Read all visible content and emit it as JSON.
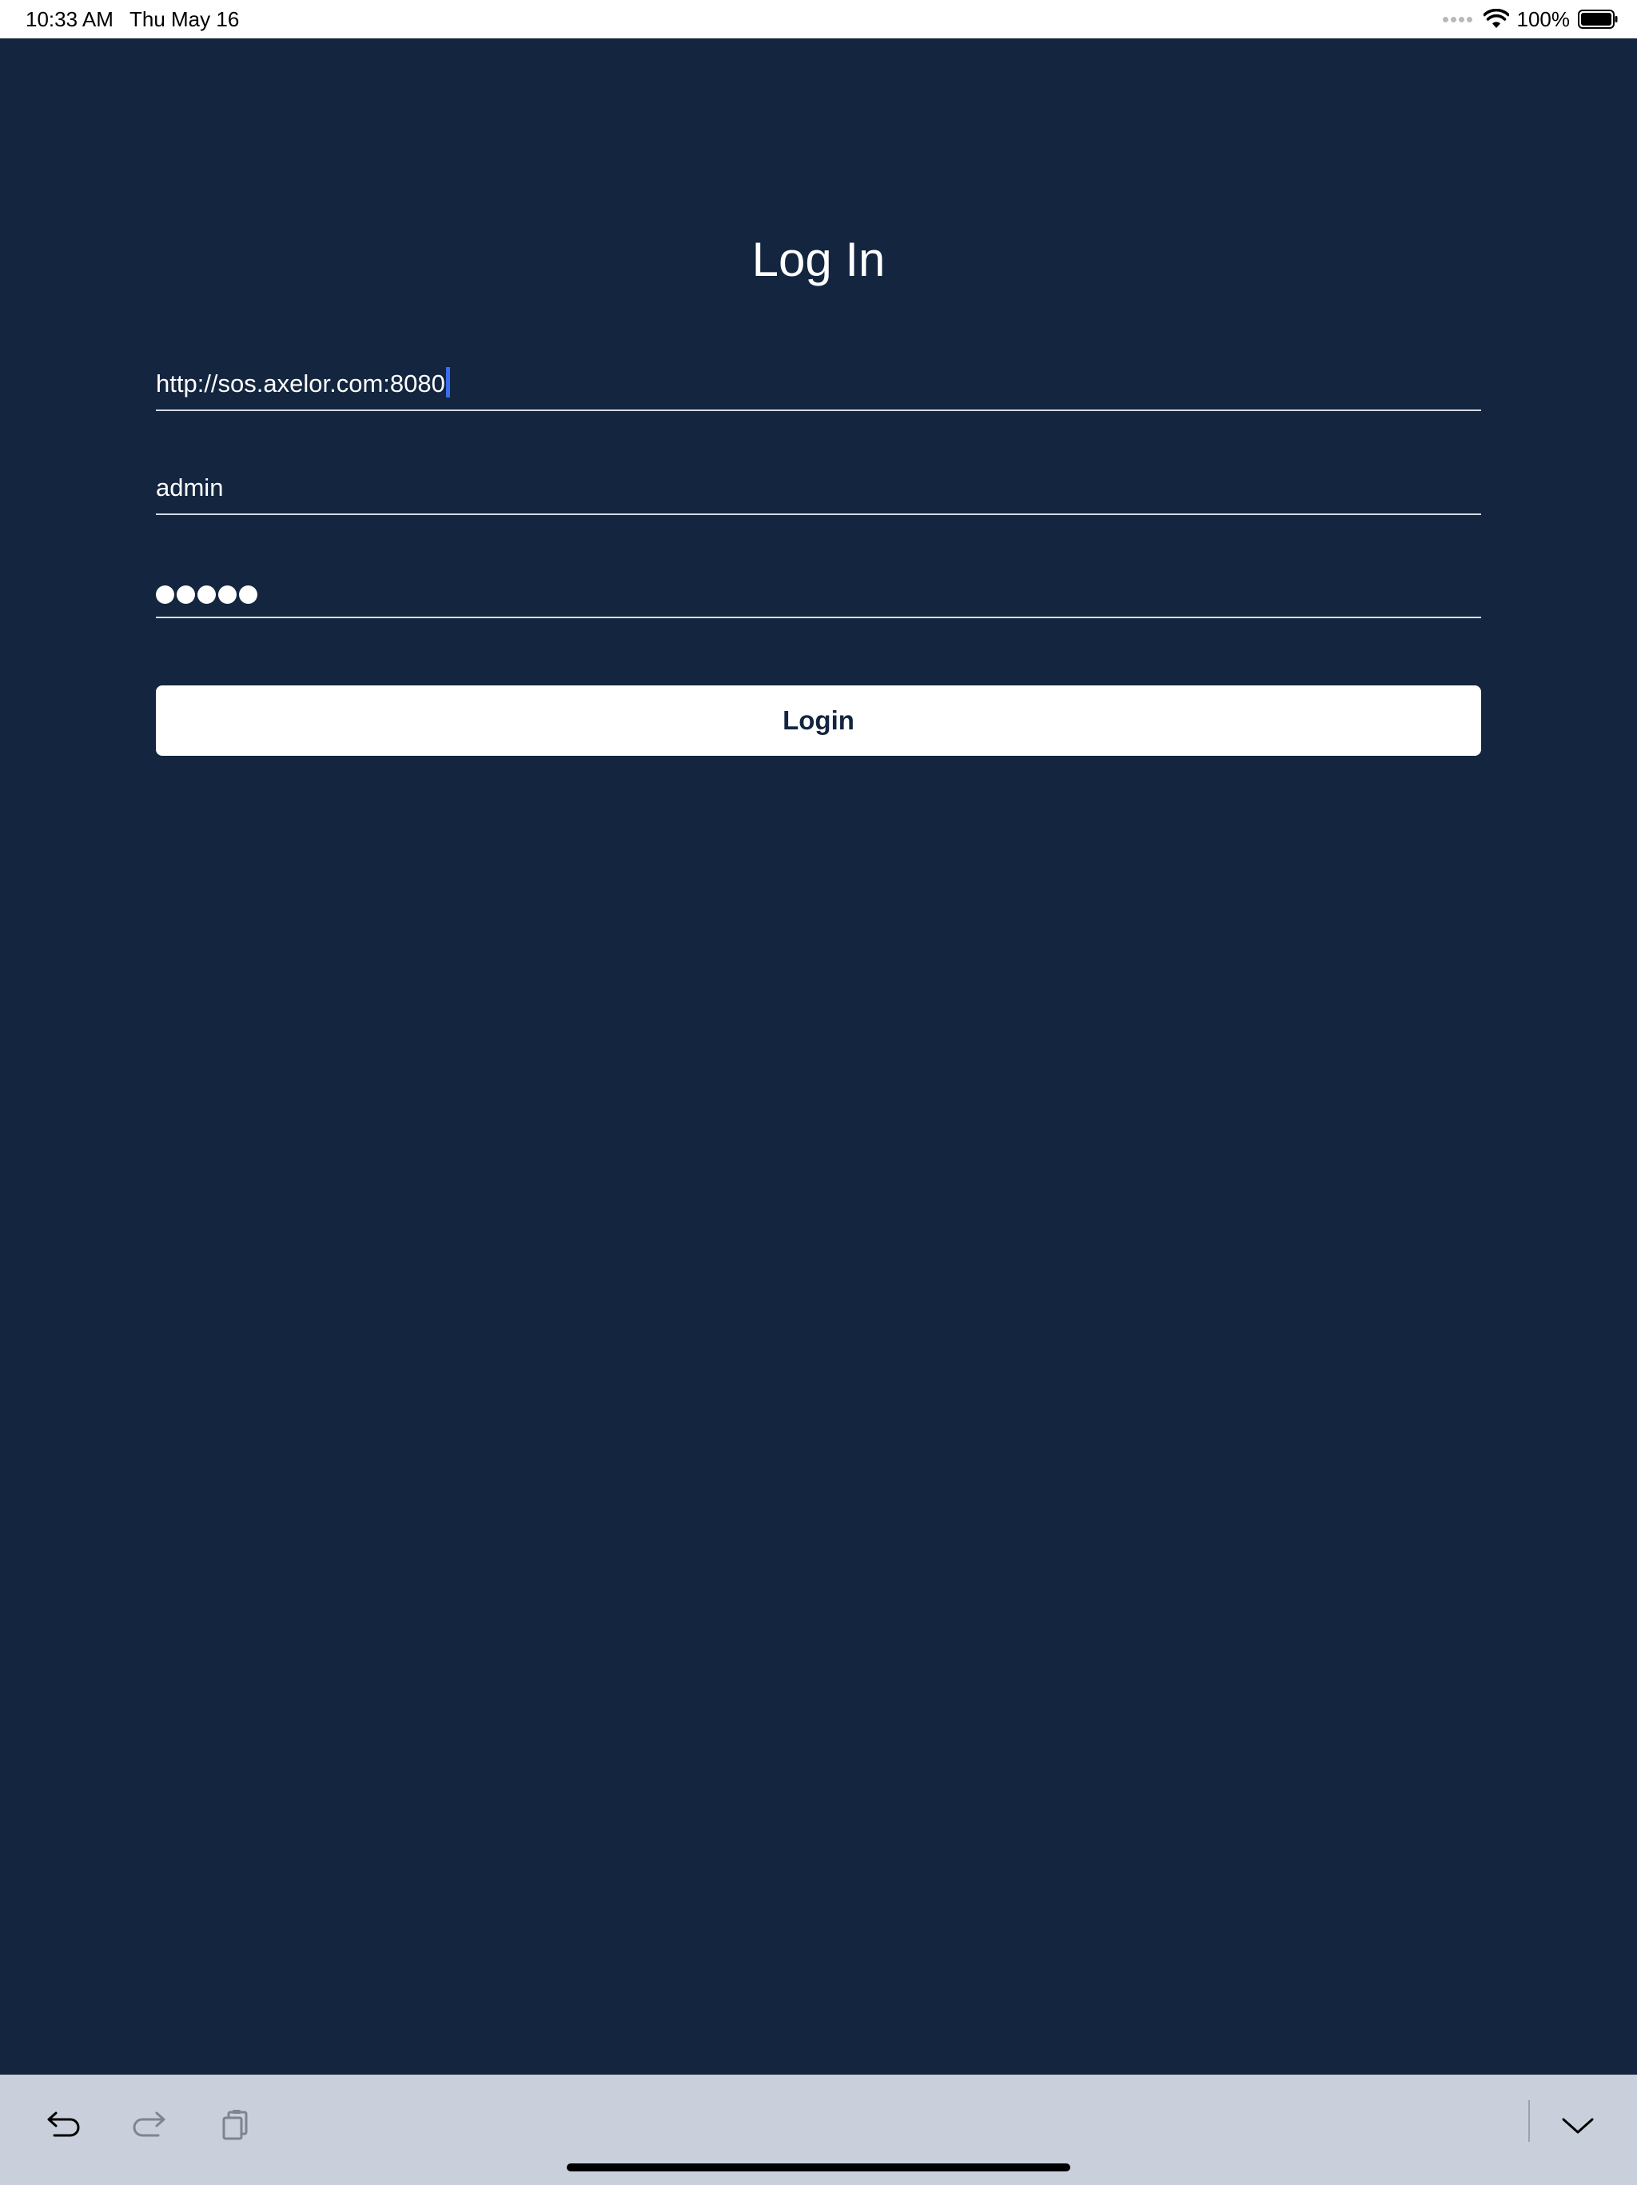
{
  "status_bar": {
    "time": "10:33 AM",
    "date": "Thu May 16",
    "battery_percent": "100%",
    "icons": [
      "cellular-dots-icon",
      "wifi-icon",
      "battery-icon"
    ]
  },
  "login": {
    "title": "Log In",
    "url_value": "http://sos.axelor.com:8080",
    "username_value": "admin",
    "password_masked_length": 5,
    "submit_label": "Login"
  },
  "shortcut_bar": {
    "icons": [
      "undo-icon",
      "redo-icon",
      "paste-icon",
      "dismiss-keyboard-icon"
    ]
  },
  "colors": {
    "background": "#13253f",
    "accent_caret": "#3a6df0",
    "button_bg": "#ffffff",
    "shortcut_bar_bg": "#c9d0db"
  }
}
